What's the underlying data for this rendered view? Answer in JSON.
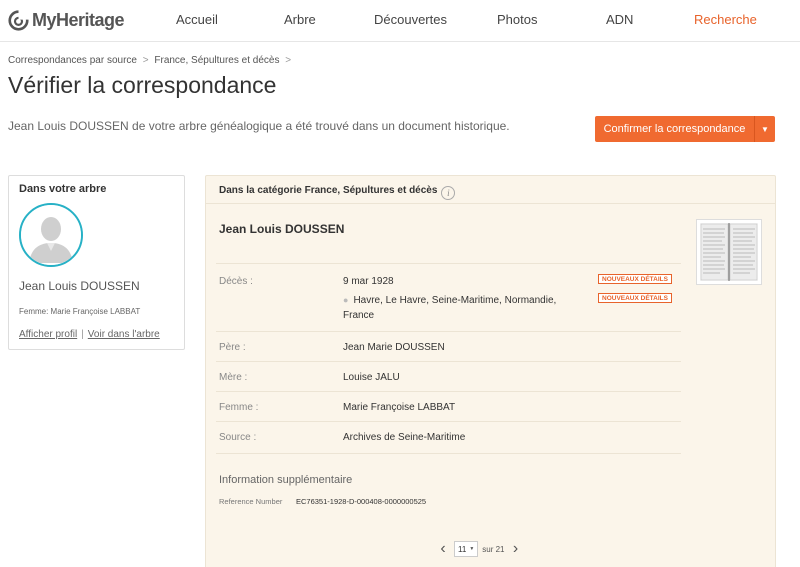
{
  "nav": {
    "logo_text": "MyHeritage",
    "logo_icon": "myheritage-logo-icon",
    "items": [
      {
        "label": "Accueil"
      },
      {
        "label": "Arbre"
      },
      {
        "label": "Découvertes"
      },
      {
        "label": "Photos"
      },
      {
        "label": "ADN"
      },
      {
        "label": "Recherche",
        "active": true
      }
    ],
    "accent_color": "#e8632b"
  },
  "breadcrumb": {
    "items": [
      "Correspondances par source",
      "France, Sépultures et décès"
    ],
    "separator": ">"
  },
  "page": {
    "title": "Vérifier la correspondance",
    "summary": "Jean Louis DOUSSEN de votre arbre généalogique a été trouvé dans un document historique."
  },
  "confirm_button": {
    "label": "Confirmer la correspondance",
    "color": "#f06a30"
  },
  "tree_card": {
    "title": "Dans votre arbre",
    "name": "Jean Louis DOUSSEN",
    "spouse": "Femme: Marie Françoise LABBAT",
    "links": [
      "Afficher profil",
      "Voir dans l'arbre"
    ],
    "link_separator": "|",
    "avatar_border_color": "#27b1c6"
  },
  "record": {
    "header": "Dans la catégorie France, Sépultures et décès",
    "info_icon": "i",
    "name": "Jean Louis DOUSSEN",
    "fields": [
      {
        "label": "Décès :",
        "value": "9 mar 1928",
        "place_line1": "Havre, Le Havre, Seine-Maritime, Normandie,",
        "place_line2": "France",
        "badges": [
          "NOUVEAUX DÉTAILS",
          "NOUVEAUX DÉTAILS"
        ]
      },
      {
        "label": "Père :",
        "value": "Jean Marie DOUSSEN"
      },
      {
        "label": "Mère :",
        "value": "Louise JALU"
      },
      {
        "label": "Femme :",
        "value": "Marie Françoise LABBAT"
      },
      {
        "label": "Source :",
        "value": "Archives de Seine-Maritime"
      }
    ],
    "extra_title": "Information supplémentaire",
    "reference_label": "Reference Number",
    "reference_value": "EC76351-1928-D-000408-0000000525",
    "background_color": "#fbf5ea"
  },
  "pager": {
    "prev_icon": "‹",
    "next_icon": "›",
    "current": "11",
    "of_text": "sur 21"
  }
}
